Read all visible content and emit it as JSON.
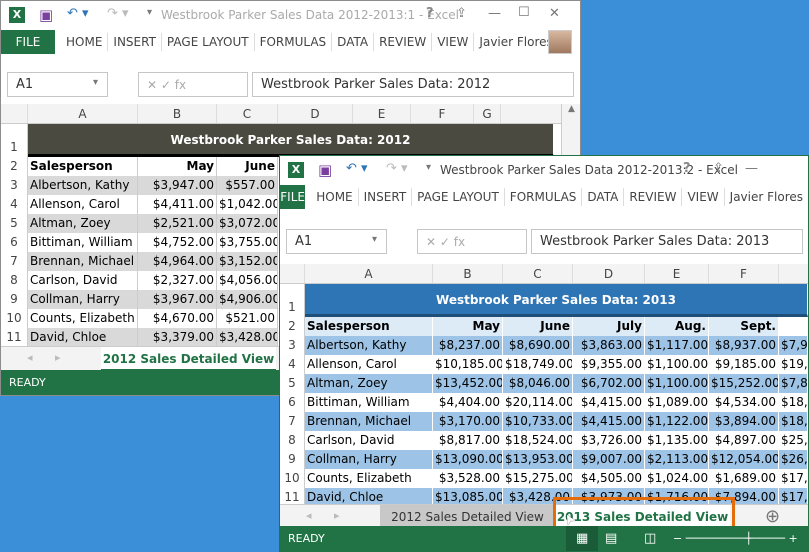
{
  "windows": [
    {
      "title": "Westbrook Parker Sales Data 2012-2013:1 - Excel",
      "ribbon_tabs": [
        "FILE",
        "HOME",
        "INSERT",
        "PAGE LAYOUT",
        "FORMULAS",
        "DATA",
        "REVIEW",
        "VIEW"
      ],
      "user": "Javier Flores",
      "name_box": "A1",
      "formula": "Westbrook Parker Sales Data: 2012",
      "columns": [
        "A",
        "B",
        "C",
        "D",
        "E",
        "F",
        "G"
      ],
      "sheet_title": "Westbrook Parker Sales Data: 2012",
      "headers": [
        "Salesperson",
        "May",
        "June"
      ],
      "rows": [
        [
          "3",
          "Albertson, Kathy",
          "$3,947.00",
          "$557.00"
        ],
        [
          "4",
          "Allenson, Carol",
          "$4,411.00",
          "$1,042.00"
        ],
        [
          "5",
          "Altman, Zoey",
          "$2,521.00",
          "$3,072.00"
        ],
        [
          "6",
          "Bittiman, William",
          "$4,752.00",
          "$3,755.00"
        ],
        [
          "7",
          "Brennan, Michael",
          "$4,964.00",
          "$3,152.00"
        ],
        [
          "8",
          "Carlson, David",
          "$2,327.00",
          "$4,056.00"
        ],
        [
          "9",
          "Collman, Harry",
          "$3,967.00",
          "$4,906.00"
        ],
        [
          "10",
          "Counts, Elizabeth",
          "$4,670.00",
          "$521.00"
        ],
        [
          "11",
          "David, Chloe",
          "$3,379.00",
          "$3,428.00"
        ]
      ],
      "sheet_tabs": [
        "2012 Sales Detailed View"
      ],
      "status": "READY"
    },
    {
      "title": "Westbrook Parker Sales Data 2012-2013:2 - Excel",
      "ribbon_tabs": [
        "FILE",
        "HOME",
        "INSERT",
        "PAGE LAYOUT",
        "FORMULAS",
        "DATA",
        "REVIEW",
        "VIEW"
      ],
      "user": "Javier Flores",
      "name_box": "A1",
      "formula": "Westbrook Parker Sales Data: 2013",
      "columns": [
        "A",
        "B",
        "C",
        "D",
        "E",
        "F"
      ],
      "sheet_title": "Westbrook Parker Sales Data: 2013",
      "headers": [
        "Salesperson",
        "May",
        "June",
        "July",
        "Aug.",
        "Sept."
      ],
      "rows": [
        [
          "3",
          "Albertson, Kathy",
          "$8,237.00",
          "$8,690.00",
          "$3,863.00",
          "$1,117.00",
          "$8,937.00",
          "$7,9"
        ],
        [
          "4",
          "Allenson, Carol",
          "$10,185.00",
          "$18,749.00",
          "$9,355.00",
          "$1,100.00",
          "$9,185.00",
          "$19,8"
        ],
        [
          "5",
          "Altman, Zoey",
          "$13,452.00",
          "$8,046.00",
          "$6,702.00",
          "$1,100.00",
          "$15,252.00",
          "$7,8"
        ],
        [
          "6",
          "Bittiman, William",
          "$4,404.00",
          "$20,114.00",
          "$4,415.00",
          "$1,089.00",
          "$4,534.00",
          "$18,1"
        ],
        [
          "7",
          "Brennan, Michael",
          "$3,170.00",
          "$10,733.00",
          "$4,415.00",
          "$1,122.00",
          "$3,894.00",
          "$18,7"
        ],
        [
          "8",
          "Carlson, David",
          "$8,817.00",
          "$18,524.00",
          "$3,726.00",
          "$1,135.00",
          "$4,897.00",
          "$25,5"
        ],
        [
          "9",
          "Collman, Harry",
          "$13,090.00",
          "$13,953.00",
          "$9,007.00",
          "$2,113.00",
          "$12,054.00",
          "$26,9"
        ],
        [
          "10",
          "Counts, Elizabeth",
          "$3,528.00",
          "$15,275.00",
          "$4,505.00",
          "$1,024.00",
          "$1,689.00",
          "$17,3"
        ],
        [
          "11",
          "David, Chloe",
          "$13,085.00",
          "$3,428.00",
          "$3,973.00",
          "$1,716.00",
          "$7,894.00",
          "$17,0"
        ]
      ],
      "sheet_tabs": [
        "2012 Sales Detailed View",
        "2013 Sales Detailed View"
      ],
      "active_tab": "2013 Sales Detailed View",
      "status": "READY"
    }
  ],
  "colors": {
    "excel_green": "#217346",
    "header_2012": "#4a4a40",
    "header_2013": "#2e75b6",
    "band_2012": "#d9d9d9",
    "band_2013": "#9dc3e6",
    "hdr_row_2013": "#ddebf7",
    "highlight": "#e46c0a"
  }
}
